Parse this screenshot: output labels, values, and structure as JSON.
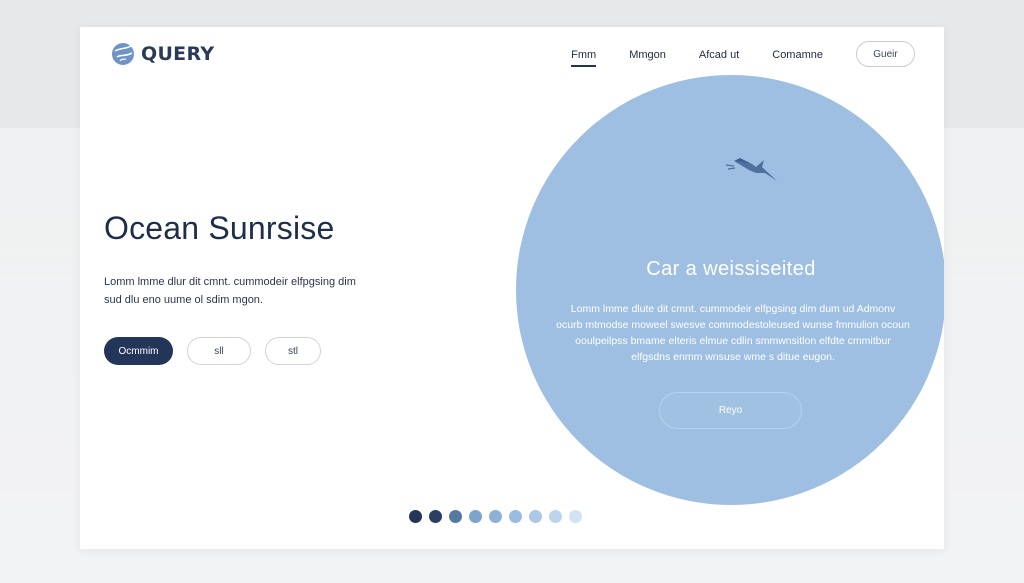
{
  "logo": {
    "text": "QUERY",
    "icon": "globe-icon"
  },
  "nav": {
    "items": [
      {
        "label": "Fmm",
        "active": true
      },
      {
        "label": "Mmgon",
        "active": false
      },
      {
        "label": "Afcad ut",
        "active": false
      },
      {
        "label": "Comamne",
        "active": false
      }
    ],
    "cta_label": "Gueir"
  },
  "hero": {
    "title": "Ocean Sunrsise",
    "description_line1": "Lomm lmme dlur dit cmnt. cummodeir elfpgsing dim",
    "description_line2": "sud dlu eno uume ol sdim mgon.",
    "primary_button": "Ocmmim",
    "secondary_button": "sll",
    "tertiary_button": "stl"
  },
  "feature": {
    "icon": "bird-icon",
    "title": "Car a weissiseited",
    "desc_line1": "Lomm lmme dlute dit cmnt. cummodeir elfpgsing dim dum ud Admonv",
    "desc_line2": "ocurb mtmodse moweel swesve commodestoleused wunse fmmulion ocoun",
    "desc_line3": "ooulpeilpss bmame elteris elmue cdlin smmwnsitlon elfdte cmmitbur",
    "desc_line4": "elfgsdns enmm wnsuse wme s ditue eugon.",
    "button_label": "Reyo"
  },
  "pagination": {
    "colors": [
      "#24355a",
      "#2c3d63",
      "#55799f",
      "#7ea3cd",
      "#8fb1d6",
      "#9cbcdf",
      "#acc8e6",
      "#bed4ec",
      "#d4e3f3"
    ]
  },
  "colors": {
    "accent": "#24355a",
    "circle": "#9ebfe2",
    "text": "#1e2d4a"
  }
}
